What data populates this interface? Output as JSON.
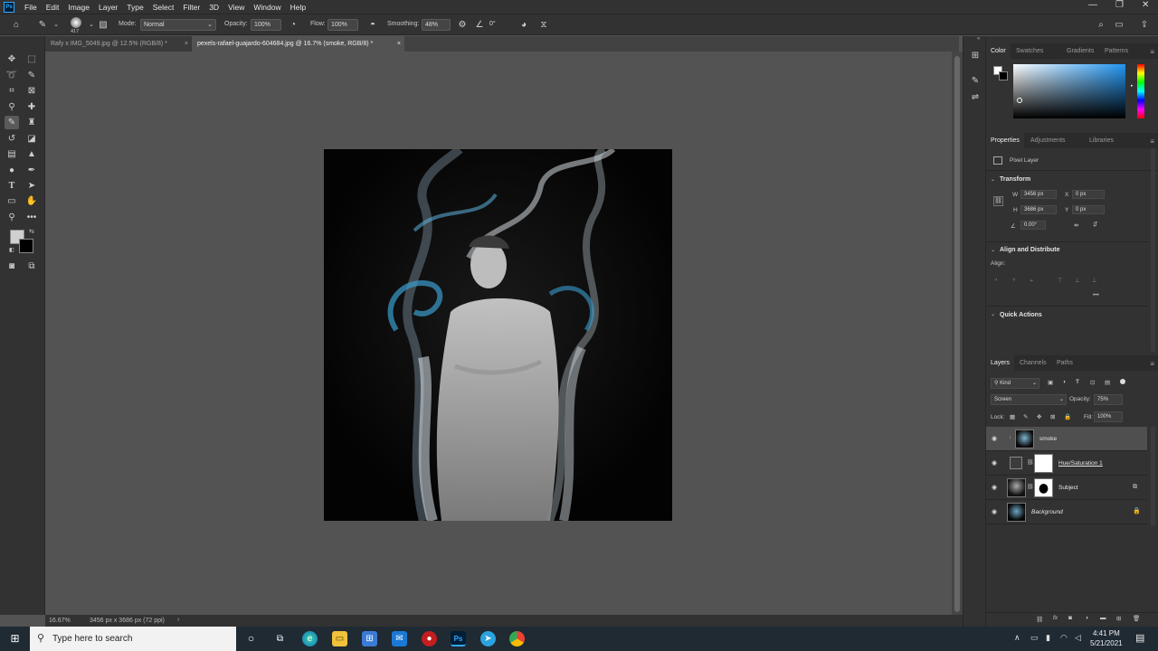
{
  "menubar": {
    "items": [
      "File",
      "Edit",
      "Image",
      "Layer",
      "Type",
      "Select",
      "Filter",
      "3D",
      "View",
      "Window",
      "Help"
    ],
    "window_controls": [
      "—",
      "❐",
      "✕"
    ]
  },
  "options": {
    "brush_size": "417",
    "mode_label": "Mode:",
    "mode_value": "Normal",
    "opacity_label": "Opacity:",
    "opacity_value": "100%",
    "flow_label": "Flow:",
    "flow_value": "100%",
    "smoothing_label": "Smoothing:",
    "smoothing_value": "48%",
    "angle_value": "0°"
  },
  "tabs": [
    {
      "label": "Rafy x IMG_5049.jpg @ 12.5% (RGB/8) *"
    },
    {
      "label": "pexels-rafael-guajardo-604684.jpg @ 16.7% (smoke, RGB/8) *"
    }
  ],
  "statusbar": {
    "zoom": "16.67%",
    "doc_size": "3456 px x 3686 px (72 ppi)"
  },
  "color_panel": {
    "tabs": [
      "Color",
      "Swatches",
      "Gradients",
      "Patterns"
    ]
  },
  "properties_panel": {
    "tabs": [
      "Properties",
      "Adjustments",
      "Libraries"
    ],
    "layer_kind": "Pixel Layer",
    "transform_title": "Transform",
    "w_label": "W",
    "w_value": "3456 px",
    "h_label": "H",
    "h_value": "3686 px",
    "x_label": "X",
    "x_value": "0 px",
    "y_label": "Y",
    "y_value": "0 px",
    "angle_value": "0.00°",
    "align_title": "Align and Distribute",
    "align_label": "Align:",
    "quick_actions_title": "Quick Actions"
  },
  "layers_panel": {
    "tabs": [
      "Layers",
      "Channels",
      "Paths"
    ],
    "kind_label": "Kind",
    "blend_mode": "Screen",
    "opacity_label": "Opacity:",
    "opacity_value": "75%",
    "lock_label": "Lock:",
    "fill_label": "Fill:",
    "fill_value": "100%",
    "layers": [
      {
        "name": "smoke"
      },
      {
        "name": "Hue/Saturation 1"
      },
      {
        "name": "Subject"
      },
      {
        "name": "Background"
      }
    ]
  },
  "taskbar": {
    "search_placeholder": "Type here to search",
    "time": "4:41 PM",
    "date": "5/21/2021"
  },
  "colors": {
    "accent": "#31a8ff",
    "panel_bg": "#323232",
    "canvas_bg": "#535353"
  }
}
